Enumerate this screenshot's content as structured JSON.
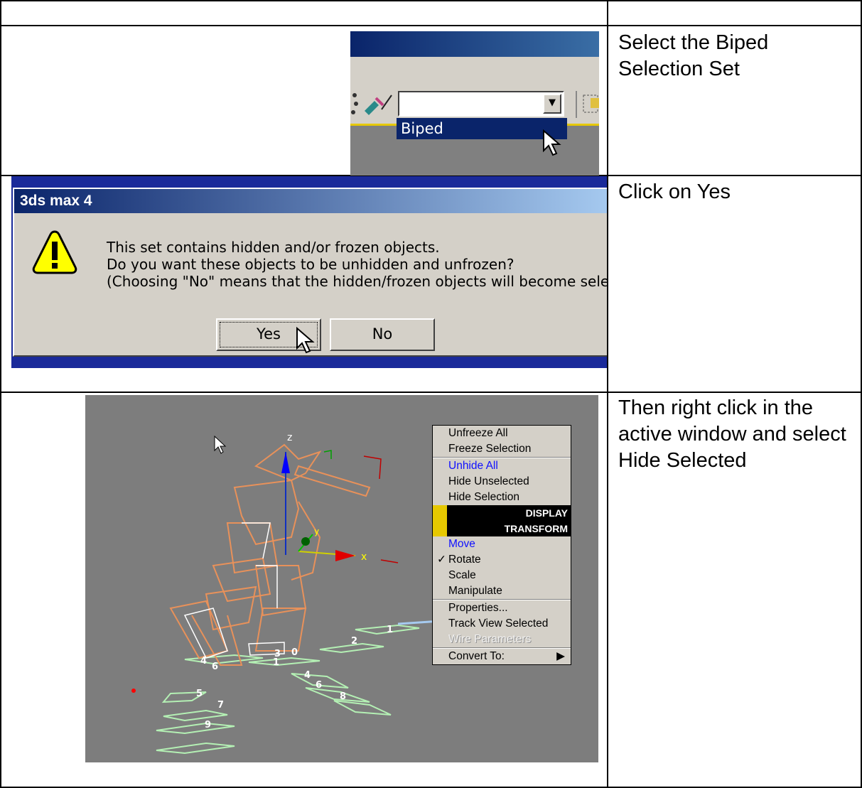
{
  "rows": [
    {
      "instruction": "",
      "screenshot": null
    },
    {
      "instruction": "Select the Biped Selection Set"
    },
    {
      "instruction": "Click on Yes"
    },
    {
      "instruction": "Then right click in the active window and select Hide Selected"
    }
  ],
  "shot1": {
    "combo_value": "",
    "dropdown_item": "Biped",
    "combo_arrow": "▼"
  },
  "shot2": {
    "title": "3ds max 4",
    "message_line1": "This set contains hidden and/or frozen objects.",
    "message_line2": "Do you want these objects to be unhidden and unfrozen?",
    "message_line3": "(Choosing \"No\" means that the hidden/frozen objects will become selected",
    "yes_label": "Yes",
    "no_label": "No",
    "warning_glyph": "!"
  },
  "shot3": {
    "axis_z": "z",
    "axis_x": "x",
    "axis_y": "y",
    "footstep_labels": [
      "1",
      "2",
      "3",
      "0",
      "4",
      "6",
      "1",
      "4",
      "6",
      "8",
      "5",
      "7",
      "9"
    ],
    "menu": {
      "items": [
        {
          "label": "Unfreeze All"
        },
        {
          "label": "Freeze Selection"
        },
        {
          "label": "Unhide All"
        },
        {
          "label": "Hide Unselected"
        },
        {
          "label": "Hide Selection"
        },
        {
          "label": "DISPLAY"
        },
        {
          "label": "TRANSFORM"
        },
        {
          "label": "Move"
        },
        {
          "label": "Rotate",
          "checked": true
        },
        {
          "label": "Scale"
        },
        {
          "label": "Manipulate"
        },
        {
          "label": "Properties..."
        },
        {
          "label": "Track View Selected"
        },
        {
          "label": "Wire Parameters",
          "disabled": true
        },
        {
          "label": "Convert To:",
          "submenu": true
        }
      ],
      "check_glyph": "✓",
      "submenu_glyph": "▶"
    }
  },
  "colors": {
    "titlebar": "#0a246a",
    "highlight": "#0a246a",
    "face": "#d4d0c8",
    "viewport": "#7d7d7d",
    "wireframe": "#e8915a",
    "footsteps": "#b4f0b4",
    "menu_blue": "#1010ff",
    "quad_yellow": "#e6c800"
  }
}
